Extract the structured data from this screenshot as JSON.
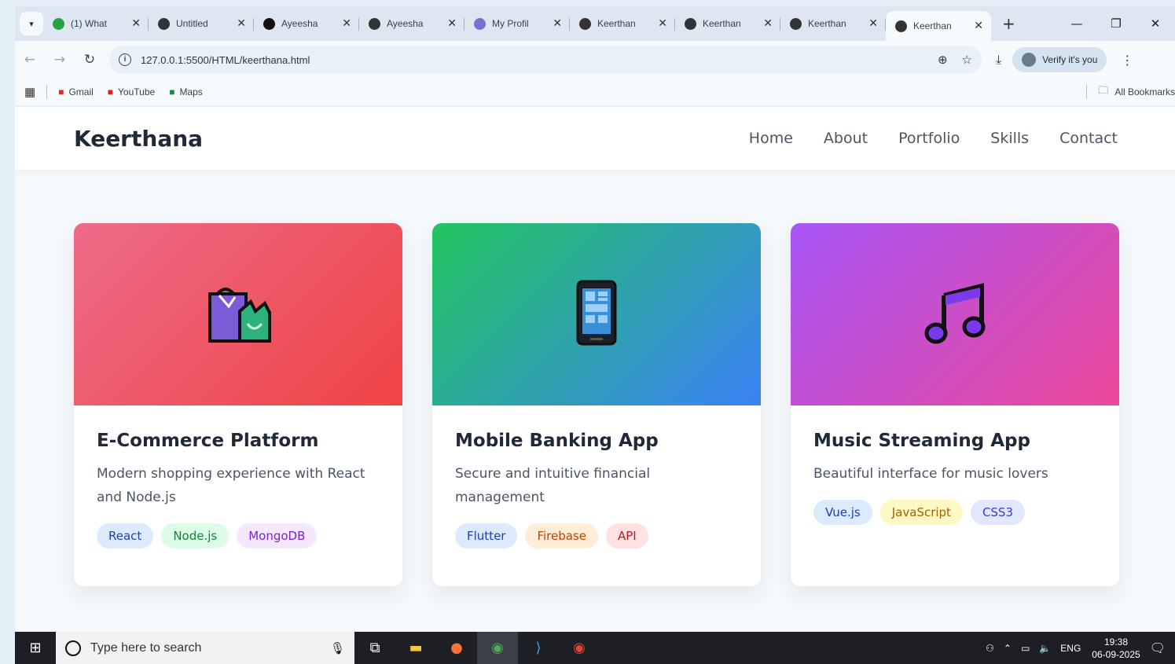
{
  "browser": {
    "tabs": [
      {
        "title": "(1) What",
        "favicon": "whatsapp-icon",
        "color": "#25a244"
      },
      {
        "title": "Untitled",
        "favicon": "globe-icon",
        "color": "#333333"
      },
      {
        "title": "Ayeesha",
        "favicon": "github-icon",
        "color": "#111111"
      },
      {
        "title": "Ayeesha",
        "favicon": "globe-icon",
        "color": "#333333"
      },
      {
        "title": "My Profil",
        "favicon": "profile-icon",
        "color": "#7b6fd6"
      },
      {
        "title": "Keerthan",
        "favicon": "pin-icon",
        "color": "#333333"
      },
      {
        "title": "Keerthan",
        "favicon": "globe-icon",
        "color": "#333333"
      },
      {
        "title": "Keerthan",
        "favicon": "globe-icon",
        "color": "#333333"
      },
      {
        "title": "Keerthan",
        "favicon": "globe-icon",
        "color": "#333333",
        "active": true
      }
    ],
    "url": "127.0.0.1:5500/HTML/keerthana.html",
    "verify_label": "Verify it's you",
    "bookmarks": [
      {
        "label": "Gmail",
        "icon": "gmail-icon",
        "color": "#d93025"
      },
      {
        "label": "YouTube",
        "icon": "youtube-icon",
        "color": "#e62117"
      },
      {
        "label": "Maps",
        "icon": "maps-icon",
        "color": "#1e8e3e"
      }
    ],
    "all_bookmarks_label": "All Bookmarks"
  },
  "site": {
    "brand": "Keerthana",
    "nav": [
      "Home",
      "About",
      "Portfolio",
      "Skills",
      "Contact"
    ]
  },
  "projects": [
    {
      "title": "E-Commerce Platform",
      "description": "Modern shopping experience with React and Node.js",
      "icon": "shopping-bags-icon",
      "gradient": [
        "#ee6b8a",
        "#ef4444"
      ],
      "tags": [
        {
          "label": "React",
          "bg": "#dbeafe",
          "fg": "#1e40af"
        },
        {
          "label": "Node.js",
          "bg": "#dcfce7",
          "fg": "#15803d"
        },
        {
          "label": "MongoDB",
          "bg": "#f3e8ff",
          "fg": "#7e22ce"
        }
      ]
    },
    {
      "title": "Mobile Banking App",
      "description": "Secure and intuitive financial management",
      "icon": "mobile-phone-icon",
      "gradient": [
        "#22c55e",
        "#3b82f6"
      ],
      "tags": [
        {
          "label": "Flutter",
          "bg": "#dbeafe",
          "fg": "#1e40af"
        },
        {
          "label": "Firebase",
          "bg": "#ffedd5",
          "fg": "#c2410c"
        },
        {
          "label": "API",
          "bg": "#fee2e2",
          "fg": "#b91c1c"
        }
      ]
    },
    {
      "title": "Music Streaming App",
      "description": "Beautiful interface for music lovers",
      "icon": "music-notes-icon",
      "gradient": [
        "#a855f7",
        "#ec4899"
      ],
      "tags": [
        {
          "label": "Vue.js",
          "bg": "#dbeafe",
          "fg": "#1e40af"
        },
        {
          "label": "JavaScript",
          "bg": "#fef9c3",
          "fg": "#a16207"
        },
        {
          "label": "CSS3",
          "bg": "#e0e7ff",
          "fg": "#4338ca"
        }
      ]
    }
  ],
  "taskbar": {
    "search_placeholder": "Type here to search",
    "lang": "ENG",
    "time": "19:38",
    "date": "06-09-2025"
  }
}
